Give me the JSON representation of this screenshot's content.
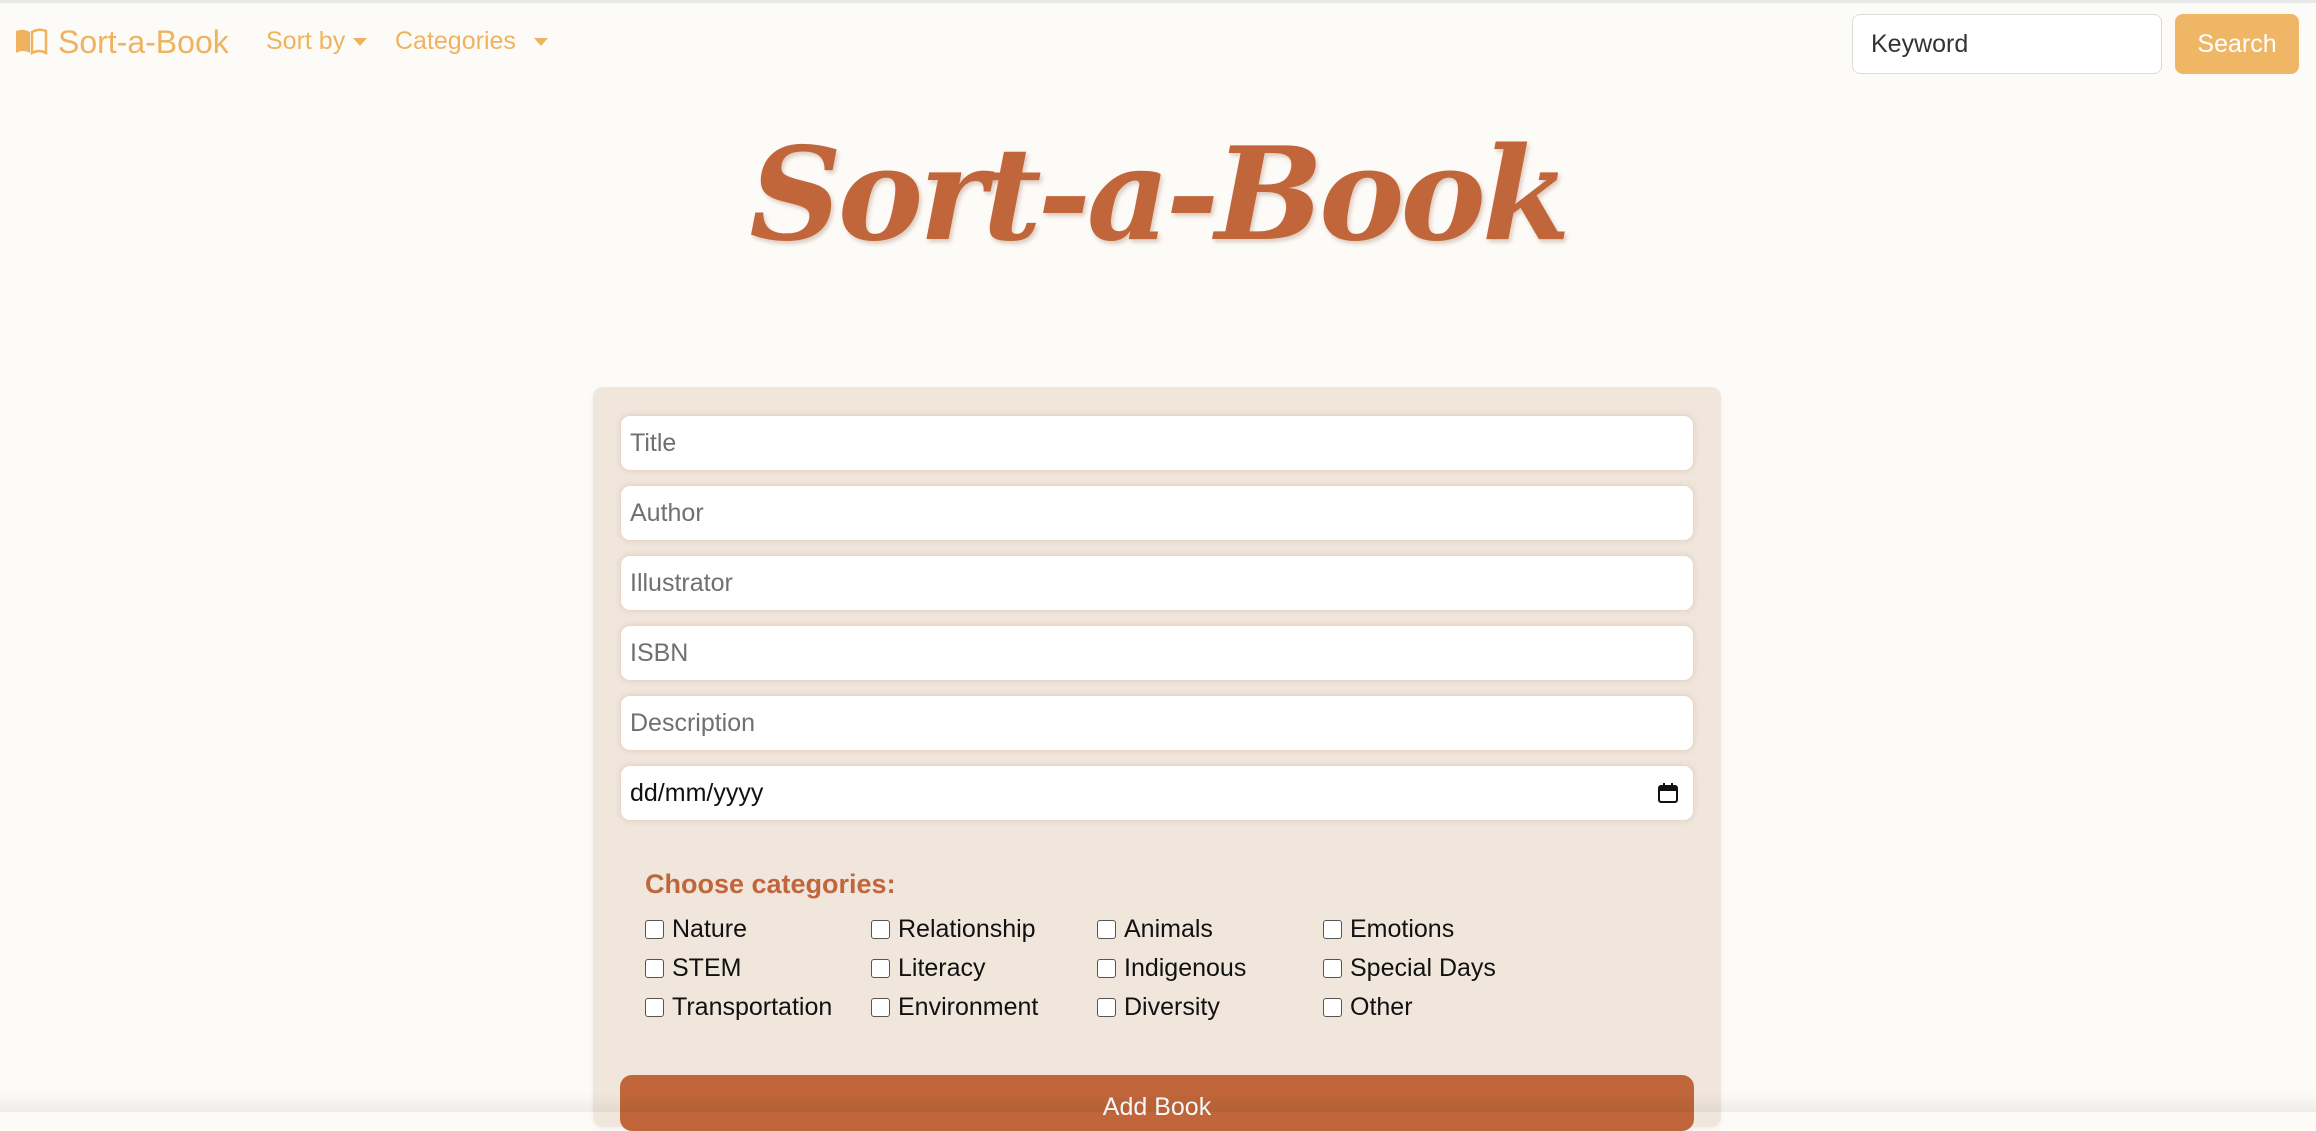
{
  "navbar": {
    "brand_label": "Sort-a-Book",
    "sort_by_label": "Sort by",
    "categories_label": "Categories",
    "search_placeholder": "Keyword",
    "search_button_label": "Search",
    "accent_color": "#efb35f"
  },
  "hero": {
    "title": "Sort-a-Book",
    "color": "#c0663a"
  },
  "form": {
    "title_placeholder": "Title",
    "author_placeholder": "Author",
    "illustrator_placeholder": "Illustrator",
    "isbn_placeholder": "ISBN",
    "description_placeholder": "Description",
    "date_placeholder": "dd/mm/yyyy",
    "categories_heading": "Choose categories:",
    "categories": [
      {
        "label": "Nature",
        "checked": false
      },
      {
        "label": "Relationship",
        "checked": false
      },
      {
        "label": "Animals",
        "checked": false
      },
      {
        "label": "Emotions",
        "checked": false
      },
      {
        "label": "STEM",
        "checked": false
      },
      {
        "label": "Literacy",
        "checked": false
      },
      {
        "label": "Indigenous",
        "checked": false
      },
      {
        "label": "Special Days",
        "checked": false
      },
      {
        "label": "Transportation",
        "checked": false
      },
      {
        "label": "Environment",
        "checked": false
      },
      {
        "label": "Diversity",
        "checked": false
      },
      {
        "label": "Other",
        "checked": false
      }
    ],
    "add_button_label": "Add Book",
    "button_color": "#c0663a"
  },
  "icons": {
    "brand": "book-open-icon",
    "dropdown": "caret-down-icon",
    "date": "calendar-icon"
  }
}
